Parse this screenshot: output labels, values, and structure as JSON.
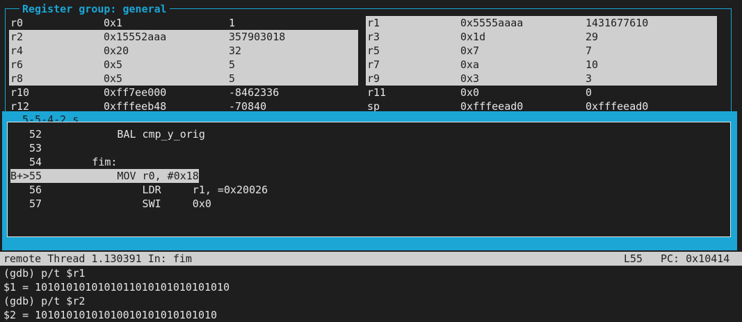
{
  "registers": {
    "title": "Register group: general",
    "rows": [
      {
        "left": {
          "name": "r0",
          "hex": "0x1",
          "dec": "1",
          "hl": false
        },
        "right": {
          "name": "r1",
          "hex": "0x5555aaaa",
          "dec": "1431677610",
          "hl": true
        }
      },
      {
        "left": {
          "name": "r2",
          "hex": "0x15552aaa",
          "dec": "357903018",
          "hl": true
        },
        "right": {
          "name": "r3",
          "hex": "0x1d",
          "dec": "29",
          "hl": true
        }
      },
      {
        "left": {
          "name": "r4",
          "hex": "0x20",
          "dec": "32",
          "hl": true
        },
        "right": {
          "name": "r5",
          "hex": "0x7",
          "dec": "7",
          "hl": true
        }
      },
      {
        "left": {
          "name": "r6",
          "hex": "0x5",
          "dec": "5",
          "hl": true
        },
        "right": {
          "name": "r7",
          "hex": "0xa",
          "dec": "10",
          "hl": true
        }
      },
      {
        "left": {
          "name": "r8",
          "hex": "0x5",
          "dec": "5",
          "hl": true
        },
        "right": {
          "name": "r9",
          "hex": "0x3",
          "dec": "3",
          "hl": true
        }
      },
      {
        "left": {
          "name": "r10",
          "hex": "0xff7ee000",
          "dec": "-8462336",
          "hl": false
        },
        "right": {
          "name": "r11",
          "hex": "0x0",
          "dec": "0",
          "hl": false
        }
      },
      {
        "left": {
          "name": "r12",
          "hex": "0xfffeeb48",
          "dec": "-70840",
          "hl": false
        },
        "right": {
          "name": "sp",
          "hex": "0xfffeead0",
          "dec": "0xfffeead0",
          "hl": false
        }
      }
    ]
  },
  "source": {
    "title": "5-5-4-2.s",
    "lines": [
      {
        "marker": "",
        "num": "52",
        "code": "            BAL cmp_y_orig",
        "current": false
      },
      {
        "marker": "",
        "num": "53",
        "code": "",
        "current": false
      },
      {
        "marker": "",
        "num": "54",
        "code": "        fim:",
        "current": false
      },
      {
        "marker": "B+>",
        "num": "55",
        "code": "            MOV r0, #0x18",
        "current": true
      },
      {
        "marker": "",
        "num": "56",
        "code": "                LDR     r1, =0x20026",
        "current": false
      },
      {
        "marker": "",
        "num": "57",
        "code": "                SWI     0x0",
        "current": false
      }
    ]
  },
  "status": {
    "thread": "remote Thread 1.130391 In: fim",
    "line": "L55",
    "pc": "PC: 0x10414"
  },
  "console": [
    "(gdb) p/t $r1",
    "$1 = 1010101010101011010101010101010",
    "(gdb) p/t $r2",
    "$2 = 10101010101010010101010101010"
  ],
  "colors": {
    "accent": "#1ba6d6",
    "background": "#1e1e1e",
    "highlight": "#cfcfcf",
    "text": "#e6e6e6"
  }
}
